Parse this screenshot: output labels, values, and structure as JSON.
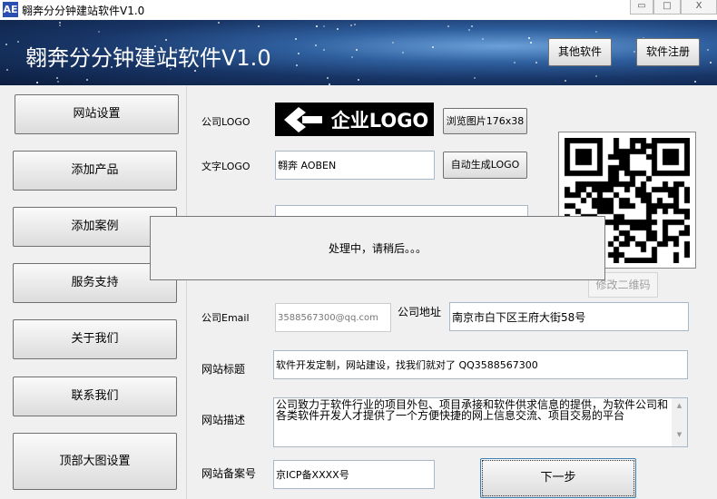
{
  "window": {
    "title": "翱奔分分钟建站软件V1.0",
    "icon": "AE",
    "min": "▭",
    "max": "□",
    "close": "X"
  },
  "banner": {
    "title": "翱奔分分钟建站软件V1.0",
    "other_software": "其他软件",
    "register": "软件注册"
  },
  "sidebar": {
    "items": [
      {
        "label": "网站设置"
      },
      {
        "label": "添加产品"
      },
      {
        "label": "添加案例"
      },
      {
        "label": "服务支持"
      },
      {
        "label": "关于我们"
      },
      {
        "label": "联系我们"
      },
      {
        "label": "顶部大图设置"
      }
    ]
  },
  "form": {
    "company_logo_label": "公司LOGO",
    "logo_text": "企业LOGO",
    "browse_button": "浏览图片176x38",
    "text_logo_label": "文字LOGO",
    "text_logo_value": "翱奔 AOBEN",
    "auto_logo_button": "自动生成LOGO",
    "modify_qr_button": "修改二维码",
    "email_label": "公司Email",
    "email_value": "3588567300@qq.com",
    "address_label": "公司地址",
    "address_value": "南京市白下区王府大街58号",
    "site_title_label": "网站标题",
    "site_title_value": "软件开发定制，网站建设，找我们就对了 QQ3588567300",
    "site_desc_label": "网站描述",
    "site_desc_value": "公司致力于软件行业的项目外包、项目承接和软件供求信息的提供，为软件公司和各类软件开发人才提供了一个方便快捷的网上信息交流、项目交易的平台",
    "icp_label": "网站备案号",
    "icp_value": "京ICP备XXXX号",
    "next_button": "下一步"
  },
  "dialog": {
    "message": "处理中，请稍后。。。"
  }
}
